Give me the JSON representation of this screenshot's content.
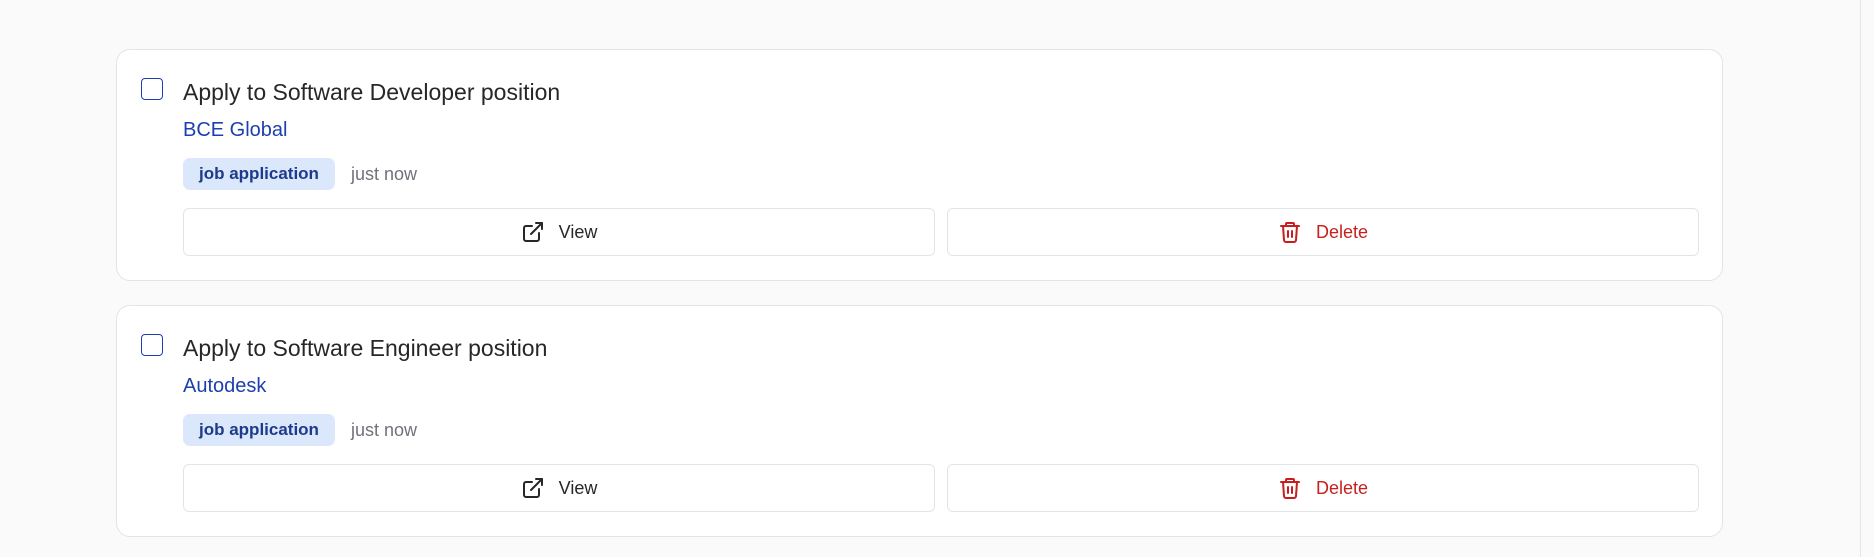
{
  "tasks": [
    {
      "title": "Apply to Software Developer position",
      "company": "BCE Global",
      "tag": "job application",
      "time": "just now",
      "view_label": "View",
      "delete_label": "Delete"
    },
    {
      "title": "Apply to Software Engineer position",
      "company": "Autodesk",
      "tag": "job application",
      "time": "just now",
      "view_label": "View",
      "delete_label": "Delete"
    }
  ],
  "icons": {
    "view": "external-link-icon",
    "delete": "trash-icon"
  },
  "colors": {
    "accent": "#1e40af",
    "tag_bg": "#dbe7fb",
    "danger": "#c81e1e"
  }
}
